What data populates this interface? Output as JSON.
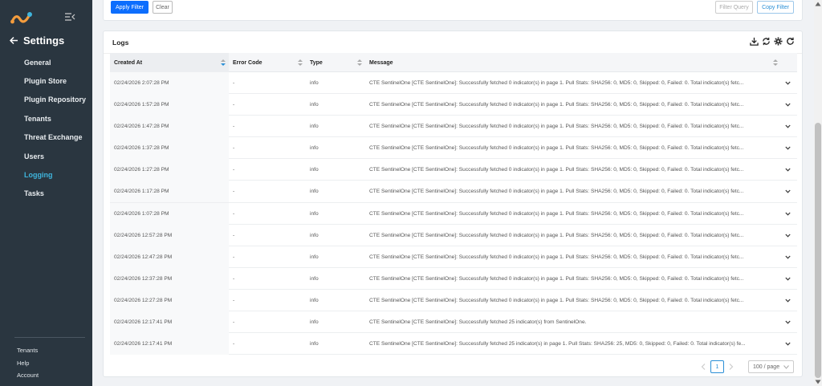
{
  "sidebar": {
    "title": "Settings",
    "items": [
      {
        "label": "General",
        "active": false
      },
      {
        "label": "Plugin Store",
        "active": false
      },
      {
        "label": "Plugin Repository",
        "active": false
      },
      {
        "label": "Tenants",
        "active": false
      },
      {
        "label": "Threat Exchange",
        "active": false
      },
      {
        "label": "Users",
        "active": false
      },
      {
        "label": "Logging",
        "active": true
      },
      {
        "label": "Tasks",
        "active": false
      }
    ],
    "bottom_items": [
      "Tenants",
      "Help",
      "Account"
    ]
  },
  "filter_bar": {
    "apply_label": "Apply Filter",
    "clear_label": "Clear",
    "filter_query_label": "Filter Query",
    "copy_filter_label": "Copy Filter"
  },
  "logs": {
    "title": "Logs",
    "toolbar_icons": [
      "download-icon",
      "sync-icon",
      "gear-icon",
      "refresh-icon"
    ],
    "columns": [
      "Created At",
      "Error Code",
      "Type",
      "Message"
    ],
    "sorted_column": "Created At",
    "rows": [
      {
        "created_at": "02/24/2026 2:07:28 PM",
        "error_code": "-",
        "type": "info",
        "message": "CTE SentinelOne [CTE SentinelOne]: Successfully fetched 0 indicator(s) in page 1. Pull Stats: SHA256: 0, MD5: 0, Skipped: 0, Failed: 0. Total indicator(s) fetc..."
      },
      {
        "created_at": "02/24/2026 1:57:28 PM",
        "error_code": "-",
        "type": "info",
        "message": "CTE SentinelOne [CTE SentinelOne]: Successfully fetched 0 indicator(s) in page 1. Pull Stats: SHA256: 0, MD5: 0, Skipped: 0, Failed: 0. Total indicator(s) fetc..."
      },
      {
        "created_at": "02/24/2026 1:47:28 PM",
        "error_code": "-",
        "type": "info",
        "message": "CTE SentinelOne [CTE SentinelOne]: Successfully fetched 0 indicator(s) in page 1. Pull Stats: SHA256: 0, MD5: 0, Skipped: 0, Failed: 0. Total indicator(s) fetc..."
      },
      {
        "created_at": "02/24/2026 1:37:28 PM",
        "error_code": "-",
        "type": "info",
        "message": "CTE SentinelOne [CTE SentinelOne]: Successfully fetched 0 indicator(s) in page 1. Pull Stats: SHA256: 0, MD5: 0, Skipped: 0, Failed: 0. Total indicator(s) fetc..."
      },
      {
        "created_at": "02/24/2026 1:27:28 PM",
        "error_code": "-",
        "type": "info",
        "message": "CTE SentinelOne [CTE SentinelOne]: Successfully fetched 0 indicator(s) in page 1. Pull Stats: SHA256: 0, MD5: 0, Skipped: 0, Failed: 0. Total indicator(s) fetc..."
      },
      {
        "created_at": "02/24/2026 1:17:28 PM",
        "error_code": "-",
        "type": "info",
        "message": "CTE SentinelOne [CTE SentinelOne]: Successfully fetched 0 indicator(s) in page 1. Pull Stats: SHA256: 0, MD5: 0, Skipped: 0, Failed: 0. Total indicator(s) fetc..."
      },
      {
        "created_at": "02/24/2026 1:07:28 PM",
        "error_code": "-",
        "type": "info",
        "message": "CTE SentinelOne [CTE SentinelOne]: Successfully fetched 0 indicator(s) in page 1. Pull Stats: SHA256: 0, MD5: 0, Skipped: 0, Failed: 0. Total indicator(s) fetc..."
      },
      {
        "created_at": "02/24/2026 12:57:28 PM",
        "error_code": "-",
        "type": "info",
        "message": "CTE SentinelOne [CTE SentinelOne]: Successfully fetched 0 indicator(s) in page 1. Pull Stats: SHA256: 0, MD5: 0, Skipped: 0, Failed: 0. Total indicator(s) fetc..."
      },
      {
        "created_at": "02/24/2026 12:47:28 PM",
        "error_code": "-",
        "type": "info",
        "message": "CTE SentinelOne [CTE SentinelOne]: Successfully fetched 0 indicator(s) in page 1. Pull Stats: SHA256: 0, MD5: 0, Skipped: 0, Failed: 0. Total indicator(s) fetc..."
      },
      {
        "created_at": "02/24/2026 12:37:28 PM",
        "error_code": "-",
        "type": "info",
        "message": "CTE SentinelOne [CTE SentinelOne]: Successfully fetched 0 indicator(s) in page 1. Pull Stats: SHA256: 0, MD5: 0, Skipped: 0, Failed: 0. Total indicator(s) fetc..."
      },
      {
        "created_at": "02/24/2026 12:27:28 PM",
        "error_code": "-",
        "type": "info",
        "message": "CTE SentinelOne [CTE SentinelOne]: Successfully fetched 0 indicator(s) in page 1. Pull Stats: SHA256: 0, MD5: 0, Skipped: 0, Failed: 0. Total indicator(s) fetc..."
      },
      {
        "created_at": "02/24/2026 12:17:41 PM",
        "error_code": "-",
        "type": "info",
        "message": "CTE SentinelOne [CTE SentinelOne]: Successfully fetched 25 indicator(s) from SentinelOne."
      },
      {
        "created_at": "02/24/2026 12:17:41 PM",
        "error_code": "-",
        "type": "info",
        "message": "CTE SentinelOne [CTE SentinelOne]: Successfully fetched 25 indicator(s) in page 1. Pull Stats: SHA256: 25, MD5: 0, Skipped: 0, Failed: 0. Total indicator(s) fe..."
      }
    ]
  },
  "pagination": {
    "current_page": "1",
    "page_size": "100 / page"
  },
  "colors": {
    "sidebar_bg": "#2a3640",
    "active_nav": "#3fb5dd",
    "primary": "#0d6efd",
    "link_blue": "#2a8fd6"
  }
}
